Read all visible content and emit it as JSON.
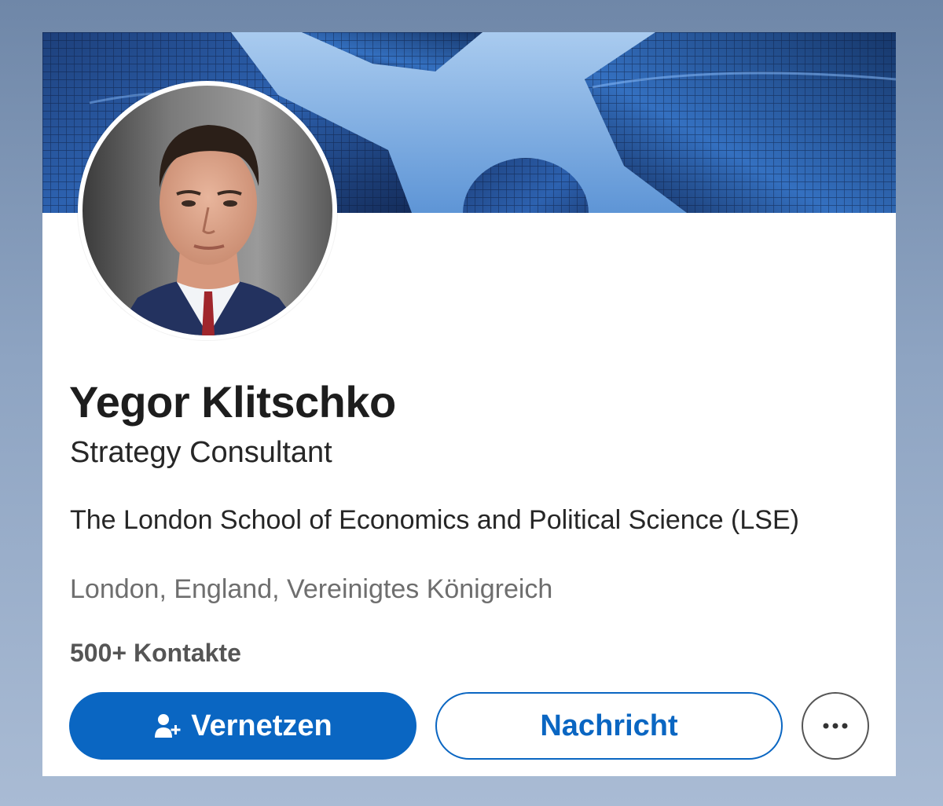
{
  "profile": {
    "name": "Yegor Klitschko",
    "headline": "Strategy Consultant",
    "education": "The London School of Economics and Political Science (LSE)",
    "location": "London, England, Vereinigtes Königreich",
    "connections": "500+ Kontakte"
  },
  "actions": {
    "connect_label": "Vernetzen",
    "connect_icon": "add-person-icon",
    "message_label": "Nachricht",
    "more_icon": "more-horizontal-icon"
  },
  "colors": {
    "accent": "#0a66c2",
    "name_text": "#1d1d1d",
    "secondary_text": "#6e6e6e"
  }
}
